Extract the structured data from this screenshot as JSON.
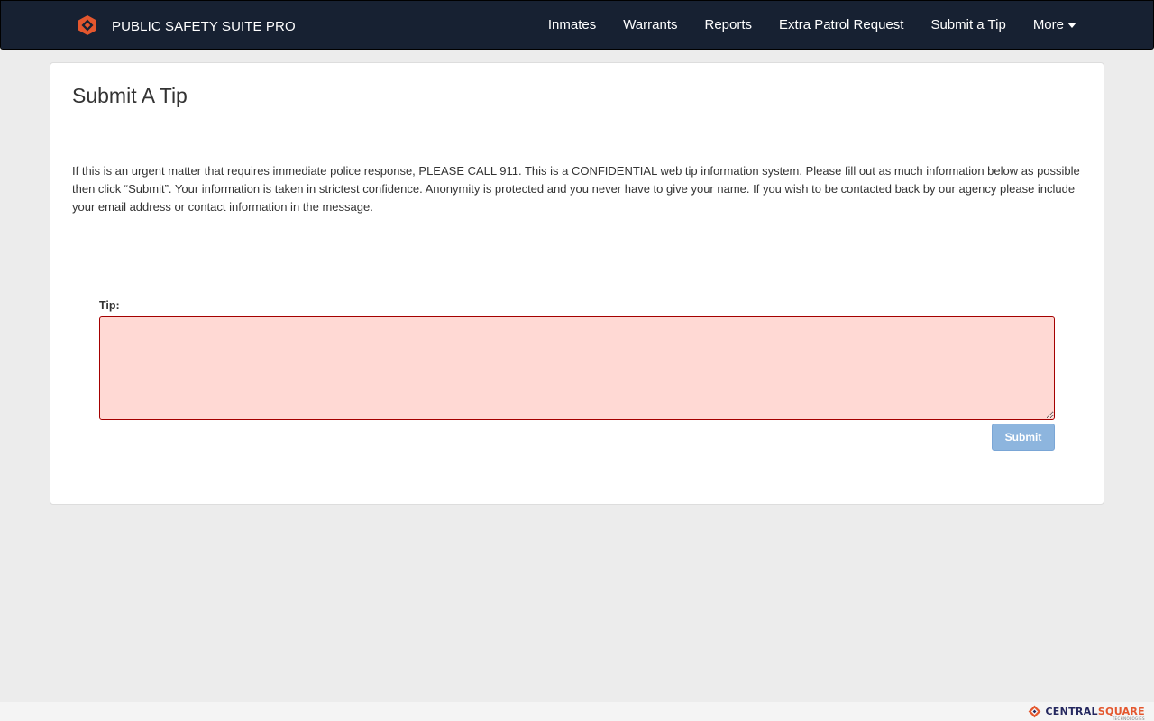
{
  "app": {
    "brand_name": "PUBLIC SAFETY SUITE PRO",
    "brand_icon": "hexagon-diamond-logo-icon",
    "colors": {
      "navbar_bg": "#172132",
      "accent_orange": "#e4572e",
      "page_bg": "#ececec",
      "error_field_bg": "#ffd9d4",
      "error_field_border": "#a40000",
      "submit_button_bg": "#8db5de"
    }
  },
  "nav": {
    "items": [
      {
        "label": "Inmates"
      },
      {
        "label": "Warrants"
      },
      {
        "label": "Reports"
      },
      {
        "label": "Extra Patrol Request"
      },
      {
        "label": "Submit a Tip"
      },
      {
        "label": "More",
        "icon": "caret-down-icon"
      }
    ]
  },
  "main": {
    "title": "Submit A Tip",
    "intro": "If this is an urgent matter that requires immediate police response, PLEASE CALL 911.  This is a CONFIDENTIAL web tip information system.  Please fill out as much information below as possible then click “Submit”.  Your information is taken in strictest confidence.  Anonymity is protected and you never have to give your name.  If you wish to be contacted back by our agency please include your email address or contact information in the message.",
    "form": {
      "tip_label": "Tip:",
      "tip_value": "",
      "submit_label": "Submit"
    }
  },
  "footer": {
    "logo_part1": "CENTRAL",
    "logo_part2": "SQUARE",
    "logo_sub": "TECHNOLOGIES",
    "logo_icon": "centralsquare-logo-icon"
  }
}
